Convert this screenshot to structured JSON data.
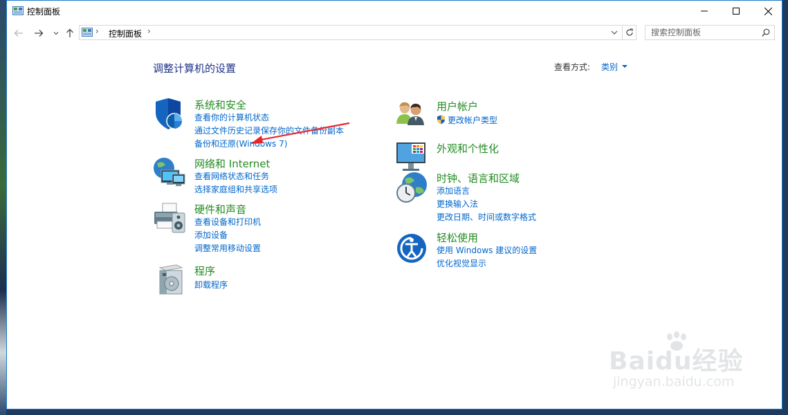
{
  "window": {
    "title": "控制面板"
  },
  "address": {
    "crumb": "控制面板",
    "separator": "›"
  },
  "search": {
    "placeholder": "搜索控制面板"
  },
  "header": {
    "title": "调整计算机的设置",
    "view_label": "查看方式:",
    "view_value": "类别"
  },
  "categories_left": [
    {
      "title": "系统和安全",
      "icon": "shield-icon",
      "links": [
        "查看你的计算机状态",
        "通过文件历史记录保存你的文件备份副本",
        "备份和还原(Windows 7)"
      ]
    },
    {
      "title": "网络和 Internet",
      "icon": "network-globe-icon",
      "links": [
        "查看网络状态和任务",
        "选择家庭组和共享选项"
      ]
    },
    {
      "title": "硬件和声音",
      "icon": "printer-icon",
      "links": [
        "查看设备和打印机",
        "添加设备",
        "调整常用移动设置"
      ]
    },
    {
      "title": "程序",
      "icon": "programs-disc-icon",
      "links": [
        "卸载程序"
      ]
    }
  ],
  "categories_right": [
    {
      "title": "用户帐户",
      "icon": "users-icon",
      "links": [
        "更改帐户类型"
      ]
    },
    {
      "title": "外观和个性化",
      "icon": "monitor-icon",
      "links": []
    },
    {
      "title": "时钟、语言和区域",
      "icon": "clock-globe-icon",
      "links": [
        "添加语言",
        "更换输入法",
        "更改日期、时间或数字格式"
      ]
    },
    {
      "title": "轻松使用",
      "icon": "ease-of-access-icon",
      "links": [
        "使用 Windows 建议的设置",
        "优化视觉显示"
      ]
    }
  ],
  "watermark": {
    "brand": "Baidu经验",
    "url": "jingyan.baidu.com"
  },
  "colors": {
    "category_title": "#228b22",
    "link": "#0066cc",
    "page_title": "#1e3287",
    "annotation_arrow": "#e8242b"
  }
}
